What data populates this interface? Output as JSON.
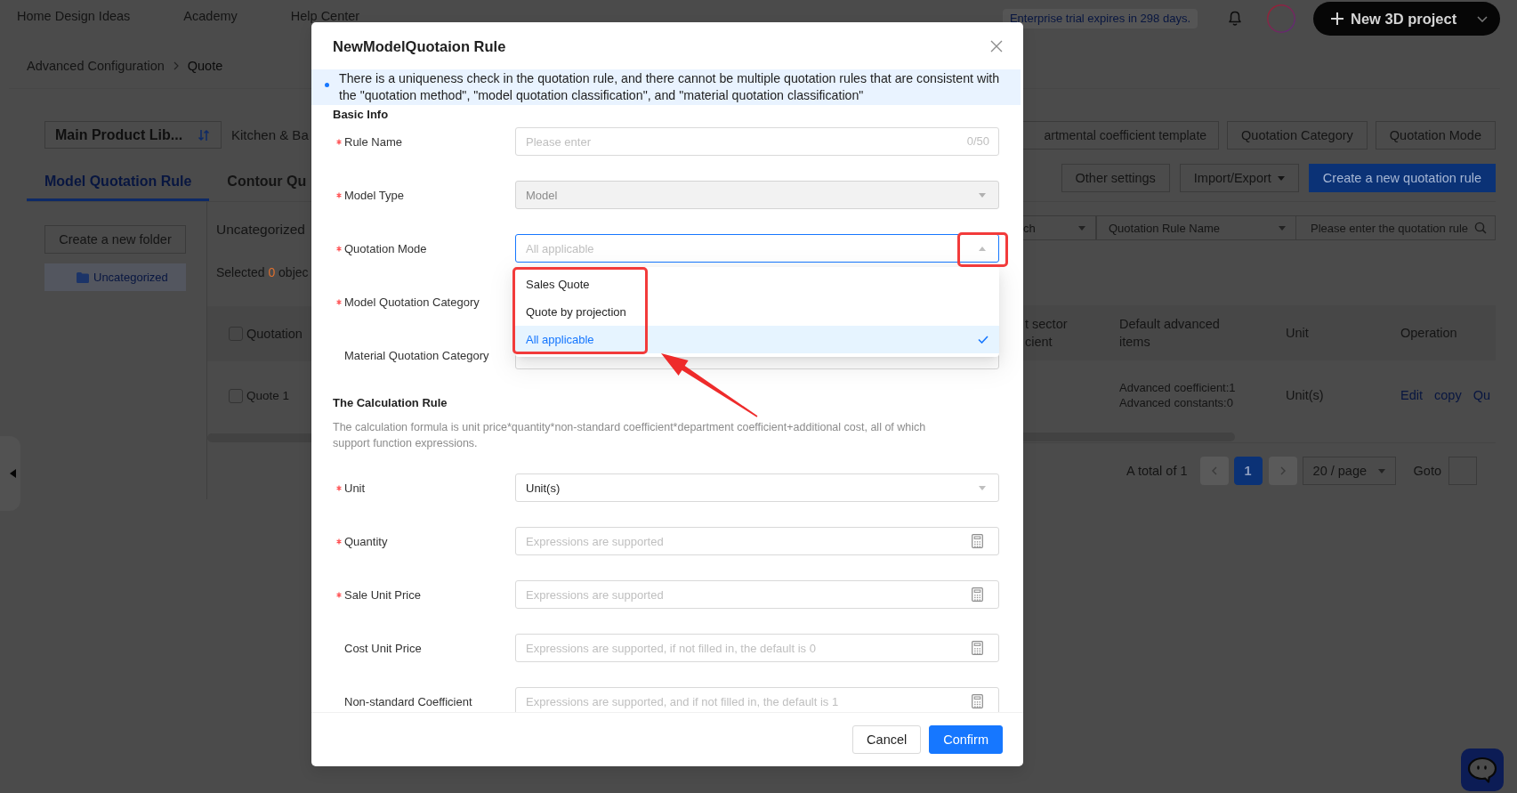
{
  "top_nav": {
    "links": [
      "Home Design Ideas",
      "Academy",
      "Help Center"
    ],
    "trial_notice": "Enterprise trial expires in 298 days.",
    "new_project_button": "New 3D project"
  },
  "breadcrumb": [
    "Advanced Configuration",
    "Quote"
  ],
  "library": {
    "selector": "Main Product Lib...",
    "label": "Kitchen & Ba"
  },
  "tabs": [
    {
      "label": "Model Quotation Rule",
      "selected": true
    },
    {
      "label": "Contour Qu",
      "selected": false
    }
  ],
  "sidebar": {
    "create_button": "Create a new folder",
    "folders": [
      {
        "label": "Uncategorized",
        "selected": true
      }
    ]
  },
  "folder_view": {
    "title": "Uncategorized",
    "selection_prefix": "Selected",
    "selection_count": "0",
    "selection_suffix": "objec"
  },
  "toolbar": {
    "settings_buttons": [
      "artmental coefficient template",
      "Quotation Category",
      "Quotation Mode"
    ],
    "actions": [
      {
        "label": "Other settings",
        "kind": "default"
      },
      {
        "label": "Import/Export",
        "kind": "dropdown"
      },
      {
        "label": "Create a new quotation rule",
        "kind": "primary"
      }
    ]
  },
  "filters": {
    "field_select": "ch",
    "name_select": "Quotation Rule Name",
    "search": {
      "placeholder": "Please enter the quotation rule"
    }
  },
  "table": {
    "select_all": {
      "checked": false
    },
    "columns": [
      {
        "lines": [
          "Quotation"
        ]
      },
      {
        "lines": [
          "t sector",
          "cient"
        ]
      },
      {
        "lines": [
          "Default advanced",
          "items"
        ]
      },
      {
        "lines": [
          "Unit"
        ]
      },
      {
        "lines": [
          "Operation"
        ]
      }
    ],
    "rows": [
      {
        "checked": false,
        "name": "Quote 1",
        "advanced_items": [
          "Advanced coefficient:1",
          "Advanced constants:0"
        ],
        "unit": "Unit(s)",
        "actions": [
          "Edit",
          "copy",
          "Qu"
        ]
      }
    ]
  },
  "pagination": {
    "total": "A total of 1",
    "prev": {
      "disabled": true
    },
    "pages": [
      {
        "label": "1",
        "selected": true
      }
    ],
    "next": {
      "disabled": true
    },
    "page_size": "20 / page",
    "goto_label": "Goto"
  },
  "dialog": {
    "title": "NewModelQuotaion Rule",
    "notice": "There is a uniqueness check in the quotation rule, and there cannot be multiple quotation rules that are consistent with the \"quotation method\", \"model quotation classification\", and \"material quotation classification\"",
    "sections": [
      {
        "heading": "Basic Info",
        "fields": [
          {
            "label": "Rule Name",
            "required": true,
            "disabled": false,
            "expanded": false,
            "kind": "text",
            "placeholder": "Please enter",
            "counter": "0/50"
          },
          {
            "label": "Model Type",
            "required": true,
            "disabled": true,
            "expanded": false,
            "kind": "select",
            "value": "Model"
          },
          {
            "label": "Quotation Mode",
            "required": true,
            "disabled": false,
            "expanded": true,
            "kind": "select",
            "value": "All applicable",
            "options": [
              {
                "label": "Sales Quote",
                "selected": false
              },
              {
                "label": "Quote by projection",
                "selected": false
              },
              {
                "label": "All applicable",
                "selected": true
              }
            ]
          },
          {
            "label": "Model Quotation Category",
            "required": true,
            "disabled": false,
            "expanded": false,
            "kind": "select"
          },
          {
            "label": "Material Quotation Category",
            "required": false,
            "disabled": false,
            "expanded": false,
            "kind": "select"
          }
        ]
      },
      {
        "heading": "The Calculation Rule",
        "description": "The calculation formula is unit price*quantity*non-standard coefficient*department coefficient+additional cost, all of which support function expressions.",
        "fields": [
          {
            "label": "Unit",
            "required": true,
            "disabled": false,
            "expanded": false,
            "kind": "select",
            "value": "Unit(s)"
          },
          {
            "label": "Quantity",
            "required": true,
            "disabled": false,
            "expanded": false,
            "kind": "expression",
            "placeholder": "Expressions are supported"
          },
          {
            "label": "Sale Unit Price",
            "required": true,
            "disabled": false,
            "expanded": false,
            "kind": "expression",
            "placeholder": "Expressions are supported"
          },
          {
            "label": "Cost Unit Price",
            "required": false,
            "disabled": false,
            "expanded": false,
            "kind": "expression",
            "placeholder": "Expressions are supported, if not filled in, the default is 0"
          },
          {
            "label": "Non-standard Coefficient",
            "required": false,
            "disabled": false,
            "expanded": false,
            "kind": "expression",
            "placeholder": "Expressions are supported, and if not filled in, the default is 1"
          }
        ]
      }
    ],
    "buttons": [
      {
        "label": "Cancel",
        "kind": "default"
      },
      {
        "label": "Confirm",
        "kind": "primary"
      }
    ]
  }
}
